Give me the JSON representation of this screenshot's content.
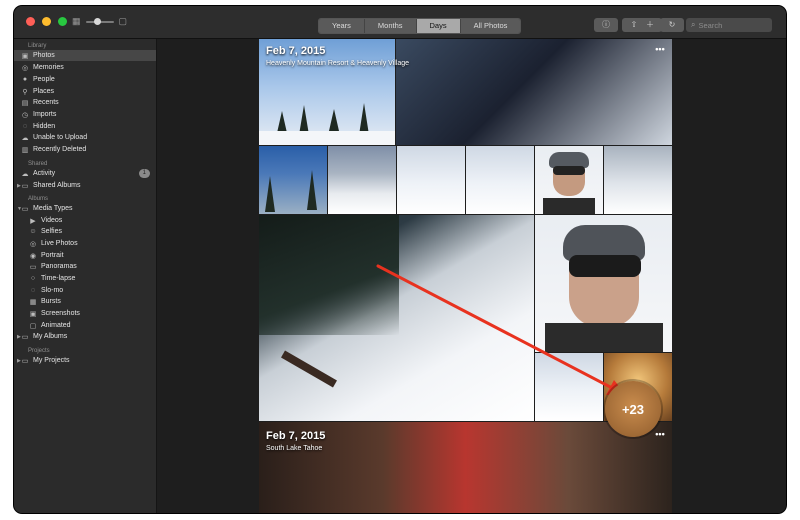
{
  "window": {
    "traffic_lights": [
      "#ff5f57",
      "#febc2e",
      "#28c840"
    ]
  },
  "toolbar": {
    "view_tabs": [
      {
        "label": "Years",
        "active": false
      },
      {
        "label": "Months",
        "active": false
      },
      {
        "label": "Days",
        "active": true
      },
      {
        "label": "All Photos",
        "active": false
      }
    ],
    "buttons": [
      "info-icon",
      "share-icon",
      "add-icon",
      "rotate-icon"
    ],
    "search_placeholder": "Search"
  },
  "sidebar": {
    "library": {
      "header": "Library",
      "items": [
        {
          "label": "Photos",
          "icon": "photos-icon",
          "selected": true
        },
        {
          "label": "Memories",
          "icon": "memories-icon"
        },
        {
          "label": "People",
          "icon": "people-icon"
        },
        {
          "label": "Places",
          "icon": "places-icon"
        },
        {
          "label": "Recents",
          "icon": "recents-icon"
        },
        {
          "label": "Imports",
          "icon": "imports-icon"
        },
        {
          "label": "Hidden",
          "icon": "hidden-icon"
        },
        {
          "label": "Unable to Upload",
          "icon": "cloud-icon"
        },
        {
          "label": "Recently Deleted",
          "icon": "trash-icon"
        }
      ]
    },
    "shared": {
      "header": "Shared",
      "items": [
        {
          "label": "Activity",
          "icon": "cloud-activity-icon",
          "badge": "1"
        },
        {
          "label": "Shared Albums",
          "icon": "folder-icon"
        }
      ]
    },
    "albums": {
      "header": "Albums",
      "media_types_label": "Media Types",
      "items": [
        {
          "label": "Videos",
          "icon": "video-icon"
        },
        {
          "label": "Selfies",
          "icon": "selfie-icon"
        },
        {
          "label": "Live Photos",
          "icon": "live-photo-icon"
        },
        {
          "label": "Portrait",
          "icon": "portrait-icon"
        },
        {
          "label": "Panoramas",
          "icon": "panorama-icon"
        },
        {
          "label": "Time-lapse",
          "icon": "timelapse-icon"
        },
        {
          "label": "Slo-mo",
          "icon": "slomo-icon"
        },
        {
          "label": "Bursts",
          "icon": "bursts-icon"
        },
        {
          "label": "Screenshots",
          "icon": "screenshot-icon"
        },
        {
          "label": "Animated",
          "icon": "animated-icon"
        }
      ],
      "my_albums_label": "My Albums"
    },
    "projects": {
      "header": "Projects",
      "my_projects_label": "My Projects"
    }
  },
  "main": {
    "groups": [
      {
        "date": "Feb 7, 2015",
        "location": "Heavenly Mountain Resort & Heavenly Village"
      },
      {
        "date": "Feb 7, 2015",
        "location": "South Lake Tahoe"
      }
    ],
    "more_count": "+23",
    "annotation_color": "#e8321f"
  }
}
